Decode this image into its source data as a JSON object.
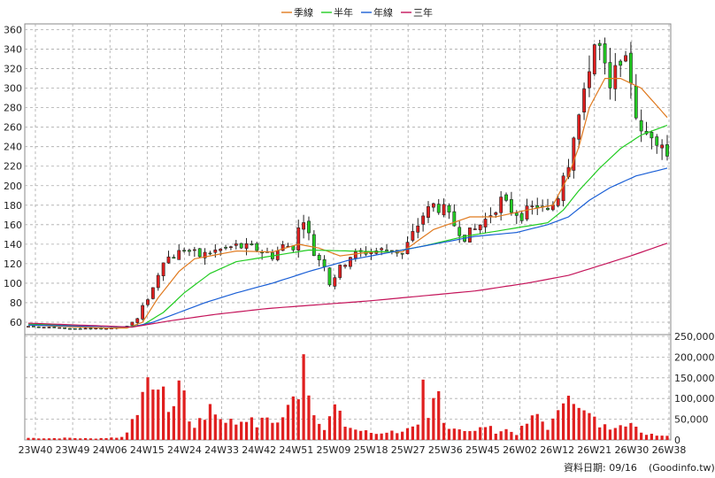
{
  "chart_data": {
    "type": "candlestick",
    "legend": [
      {
        "label": "季線",
        "color": "#e07a1f"
      },
      {
        "label": "半年",
        "color": "#22cc22"
      },
      {
        "label": "年線",
        "color": "#1a5fd6"
      },
      {
        "label": "三年",
        "color": "#c4145a"
      }
    ],
    "legend_position": "top-center",
    "grid": true,
    "price_axis": {
      "side": "left",
      "ylim": [
        50,
        365
      ],
      "ticks": [
        "60",
        "80",
        "100",
        "120",
        "140",
        "160",
        "180",
        "200",
        "220",
        "240",
        "260",
        "280",
        "300",
        "320",
        "340",
        "360"
      ]
    },
    "volume_axis": {
      "side": "right",
      "ylim": [
        0,
        250000
      ],
      "ticks": [
        "0",
        "50,000",
        "100,000",
        "150,000",
        "200,000",
        "250,000"
      ]
    },
    "x_ticks": [
      "23W40",
      "23W49",
      "24W06",
      "24W15",
      "24W24",
      "24W33",
      "24W42",
      "24W51",
      "25W09",
      "25W18",
      "25W27",
      "25W36",
      "25W45",
      "26W02",
      "26W12",
      "26W21",
      "26W30",
      "26W38"
    ],
    "price_keypoints": [
      [
        0,
        56
      ],
      [
        6,
        54
      ],
      [
        12,
        53
      ],
      [
        16,
        54
      ],
      [
        19,
        56
      ],
      [
        20,
        60
      ],
      [
        21,
        63
      ],
      [
        22,
        75
      ],
      [
        23,
        85
      ],
      [
        24,
        95
      ],
      [
        25,
        110
      ],
      [
        26,
        125
      ],
      [
        28,
        128
      ],
      [
        30,
        135
      ],
      [
        33,
        128
      ],
      [
        36,
        133
      ],
      [
        40,
        138
      ],
      [
        44,
        135
      ],
      [
        47,
        128
      ],
      [
        49,
        138
      ],
      [
        51,
        138
      ],
      [
        52,
        155
      ],
      [
        53,
        168
      ],
      [
        55,
        130
      ],
      [
        57,
        120
      ],
      [
        58,
        100
      ],
      [
        60,
        115
      ],
      [
        62,
        128
      ],
      [
        65,
        132
      ],
      [
        70,
        135
      ],
      [
        72,
        130
      ],
      [
        74,
        150
      ],
      [
        76,
        170
      ],
      [
        78,
        180
      ],
      [
        80,
        175
      ],
      [
        82,
        160
      ],
      [
        84,
        148
      ],
      [
        86,
        155
      ],
      [
        88,
        165
      ],
      [
        91,
        185
      ],
      [
        93,
        175
      ],
      [
        95,
        170
      ],
      [
        98,
        180
      ],
      [
        100,
        172
      ],
      [
        102,
        190
      ],
      [
        103,
        215
      ],
      [
        104,
        225
      ],
      [
        105,
        255
      ],
      [
        107,
        290
      ],
      [
        108,
        325
      ],
      [
        109,
        345
      ],
      [
        110,
        340
      ],
      [
        112,
        295
      ],
      [
        114,
        335
      ],
      [
        116,
        310
      ],
      [
        117,
        275
      ],
      [
        118,
        250
      ],
      [
        120,
        255
      ],
      [
        122,
        245
      ],
      [
        123,
        230
      ]
    ],
    "volume_keypoints": [
      [
        0,
        5000
      ],
      [
        4,
        4000
      ],
      [
        8,
        5000
      ],
      [
        12,
        3500
      ],
      [
        16,
        5500
      ],
      [
        18,
        7000
      ],
      [
        19,
        18000
      ],
      [
        20,
        60000
      ],
      [
        22,
        95000
      ],
      [
        24,
        150000
      ],
      [
        25,
        125000
      ],
      [
        26,
        105000
      ],
      [
        27,
        80000
      ],
      [
        28,
        85000
      ],
      [
        29,
        140000
      ],
      [
        30,
        110000
      ],
      [
        31,
        50000
      ],
      [
        32,
        35000
      ],
      [
        34,
        50000
      ],
      [
        35,
        100000
      ],
      [
        36,
        60000
      ],
      [
        38,
        50000
      ],
      [
        40,
        40000
      ],
      [
        42,
        55000
      ],
      [
        44,
        35000
      ],
      [
        46,
        55000
      ],
      [
        48,
        40000
      ],
      [
        50,
        75000
      ],
      [
        52,
        120000
      ],
      [
        53,
        240000
      ],
      [
        54,
        110000
      ],
      [
        55,
        75000
      ],
      [
        57,
        25000
      ],
      [
        59,
        80000
      ],
      [
        61,
        35000
      ],
      [
        63,
        25000
      ],
      [
        65,
        20000
      ],
      [
        67,
        15000
      ],
      [
        69,
        20000
      ],
      [
        71,
        20000
      ],
      [
        73,
        25000
      ],
      [
        75,
        30000
      ],
      [
        76,
        120000
      ],
      [
        77,
        45000
      ],
      [
        78,
        90000
      ],
      [
        79,
        110000
      ],
      [
        80,
        40000
      ],
      [
        82,
        30000
      ],
      [
        84,
        25000
      ],
      [
        86,
        20000
      ],
      [
        88,
        35000
      ],
      [
        90,
        20000
      ],
      [
        92,
        25000
      ],
      [
        94,
        15000
      ],
      [
        96,
        40000
      ],
      [
        98,
        60000
      ],
      [
        100,
        30000
      ],
      [
        102,
        60000
      ],
      [
        104,
        140000
      ],
      [
        106,
        70000
      ],
      [
        108,
        60000
      ],
      [
        110,
        35000
      ],
      [
        112,
        30000
      ],
      [
        114,
        45000
      ],
      [
        116,
        40000
      ],
      [
        118,
        15000
      ],
      [
        120,
        15000
      ],
      [
        123,
        10000
      ]
    ],
    "ma_keypoints": {
      "季線": [
        [
          0,
          57
        ],
        [
          15,
          54
        ],
        [
          19,
          54
        ],
        [
          22,
          60
        ],
        [
          25,
          85
        ],
        [
          29,
          112
        ],
        [
          32,
          125
        ],
        [
          40,
          133
        ],
        [
          47,
          132
        ],
        [
          52,
          140
        ],
        [
          56,
          136
        ],
        [
          60,
          128
        ],
        [
          66,
          132
        ],
        [
          72,
          132
        ],
        [
          78,
          155
        ],
        [
          85,
          168
        ],
        [
          90,
          168
        ],
        [
          96,
          175
        ],
        [
          101,
          180
        ],
        [
          104,
          210
        ],
        [
          106,
          240
        ],
        [
          108,
          280
        ],
        [
          111,
          310
        ],
        [
          114,
          310
        ],
        [
          118,
          300
        ],
        [
          123,
          270
        ]
      ],
      "半年": [
        [
          0,
          58
        ],
        [
          19,
          55
        ],
        [
          22,
          57
        ],
        [
          26,
          70
        ],
        [
          30,
          90
        ],
        [
          35,
          110
        ],
        [
          40,
          122
        ],
        [
          47,
          128
        ],
        [
          54,
          134
        ],
        [
          62,
          133
        ],
        [
          70,
          132
        ],
        [
          76,
          138
        ],
        [
          84,
          148
        ],
        [
          92,
          155
        ],
        [
          100,
          162
        ],
        [
          103,
          175
        ],
        [
          106,
          195
        ],
        [
          110,
          218
        ],
        [
          114,
          238
        ],
        [
          118,
          252
        ],
        [
          123,
          262
        ]
      ],
      "年線": [
        [
          0,
          57
        ],
        [
          20,
          55
        ],
        [
          24,
          60
        ],
        [
          28,
          68
        ],
        [
          34,
          80
        ],
        [
          40,
          90
        ],
        [
          47,
          100
        ],
        [
          54,
          112
        ],
        [
          62,
          124
        ],
        [
          70,
          132
        ],
        [
          78,
          140
        ],
        [
          86,
          148
        ],
        [
          94,
          152
        ],
        [
          100,
          160
        ],
        [
          104,
          168
        ],
        [
          108,
          185
        ],
        [
          112,
          198
        ],
        [
          117,
          210
        ],
        [
          123,
          218
        ]
      ],
      "三年": [
        [
          0,
          59
        ],
        [
          20,
          55
        ],
        [
          28,
          62
        ],
        [
          36,
          68
        ],
        [
          46,
          74
        ],
        [
          56,
          78
        ],
        [
          66,
          82
        ],
        [
          76,
          87
        ],
        [
          86,
          92
        ],
        [
          96,
          100
        ],
        [
          104,
          108
        ],
        [
          110,
          118
        ],
        [
          116,
          128
        ],
        [
          123,
          141
        ]
      ]
    }
  },
  "footer": {
    "date_label": "資料日期: 09/16",
    "source_label": "(Goodinfo.tw)"
  }
}
